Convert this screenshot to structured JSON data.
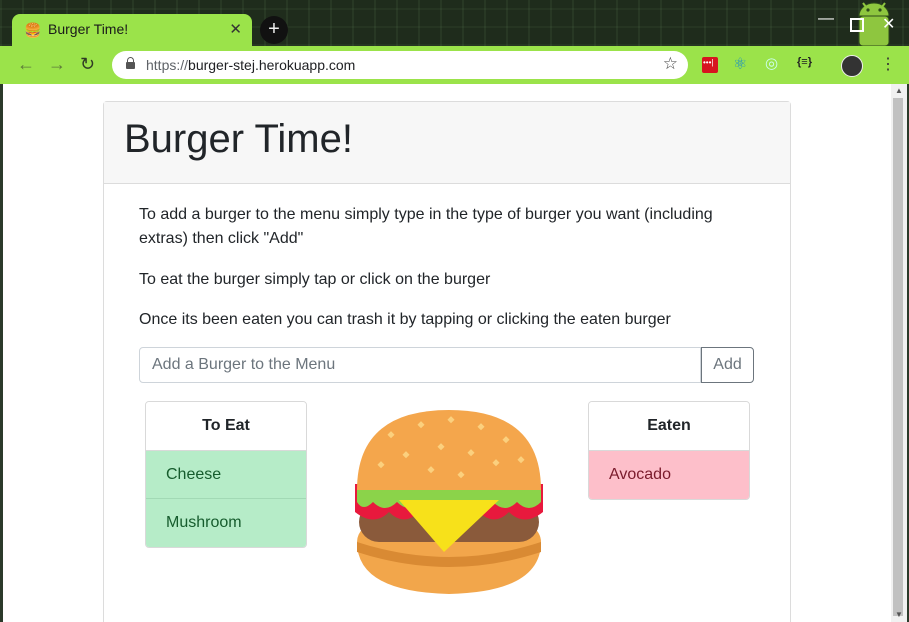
{
  "browser": {
    "tab_title": "Burger Time!",
    "tab_favicon": "🍔",
    "url_scheme": "https://",
    "url_host": "burger-stej.herokuapp.com"
  },
  "page": {
    "heading": "Burger Time!",
    "instructions": [
      "To add a burger to the menu simply type in the type of burger you want (including extras) then click \"Add\"",
      "To eat the burger simply tap or click on the burger",
      "Once its been eaten you can trash it by tapping or clicking the eaten burger"
    ],
    "input_placeholder": "Add a Burger to the Menu",
    "add_label": "Add",
    "to_eat": {
      "header": "To Eat",
      "items": [
        "Cheese",
        "Mushroom"
      ]
    },
    "eaten": {
      "header": "Eaten",
      "items": [
        "Avocado"
      ]
    }
  },
  "colors": {
    "toolbar": "#9be34a",
    "to_eat_item_bg": "#b6ecc8",
    "eaten_item_bg": "#fdbfca"
  }
}
